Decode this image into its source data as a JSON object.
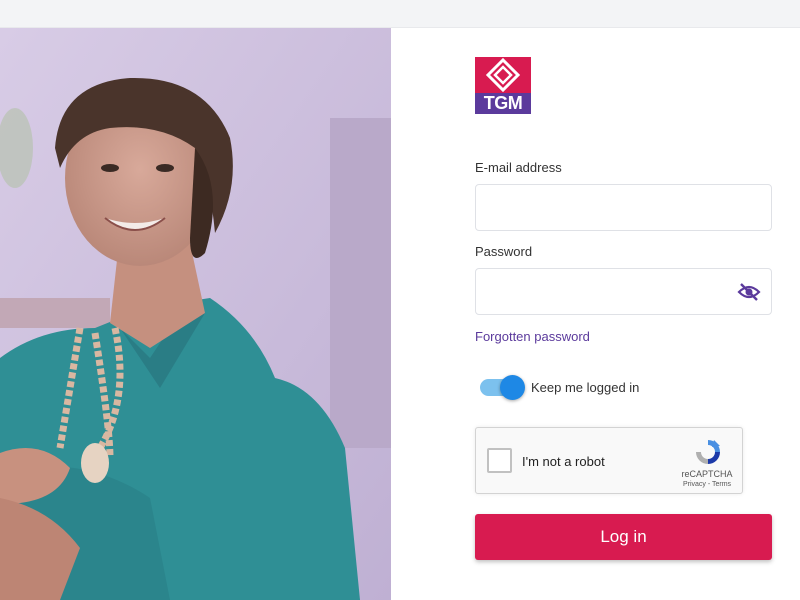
{
  "logo": {
    "text": "TGM",
    "colors": {
      "top": "#d81b50",
      "bottom": "#5b3a9c"
    }
  },
  "form": {
    "email": {
      "label": "E-mail address",
      "value": "",
      "placeholder": ""
    },
    "password": {
      "label": "Password",
      "value": "",
      "placeholder": "",
      "visibility_icon": "eye-off-icon"
    },
    "forgot_link": "Forgotten password",
    "keep_logged_in": {
      "label": "Keep me logged in",
      "checked": true
    },
    "recaptcha": {
      "text": "I'm not a robot",
      "brand": "reCAPTCHA",
      "privacy": "Privacy",
      "separator": " - ",
      "terms": "Terms"
    },
    "login_button": "Log in"
  },
  "colors": {
    "primary": "#d81b50",
    "link": "#5b3a9c",
    "toggle": "#1e88e5"
  }
}
